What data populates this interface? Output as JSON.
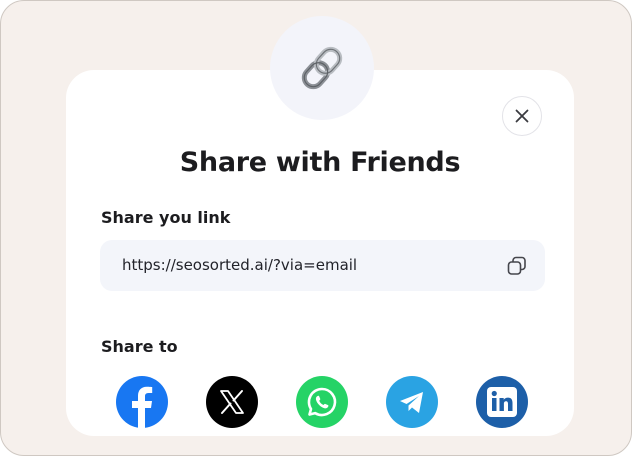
{
  "dialog": {
    "title": "Share with Friends",
    "link_section_label": "Share you link",
    "link_value": "https://seosorted.ai/?via=email",
    "share_section_label": "Share to"
  },
  "icons": {
    "header": "link-chain-icon",
    "close": "close-icon",
    "copy": "copy-icon"
  },
  "social": [
    {
      "name": "facebook",
      "color": "#1877f2"
    },
    {
      "name": "x",
      "color": "#000000"
    },
    {
      "name": "whatsapp",
      "color": "#25d366"
    },
    {
      "name": "telegram",
      "color": "#2aa3e3"
    },
    {
      "name": "linkedin",
      "color": "#1d5fa8"
    }
  ]
}
